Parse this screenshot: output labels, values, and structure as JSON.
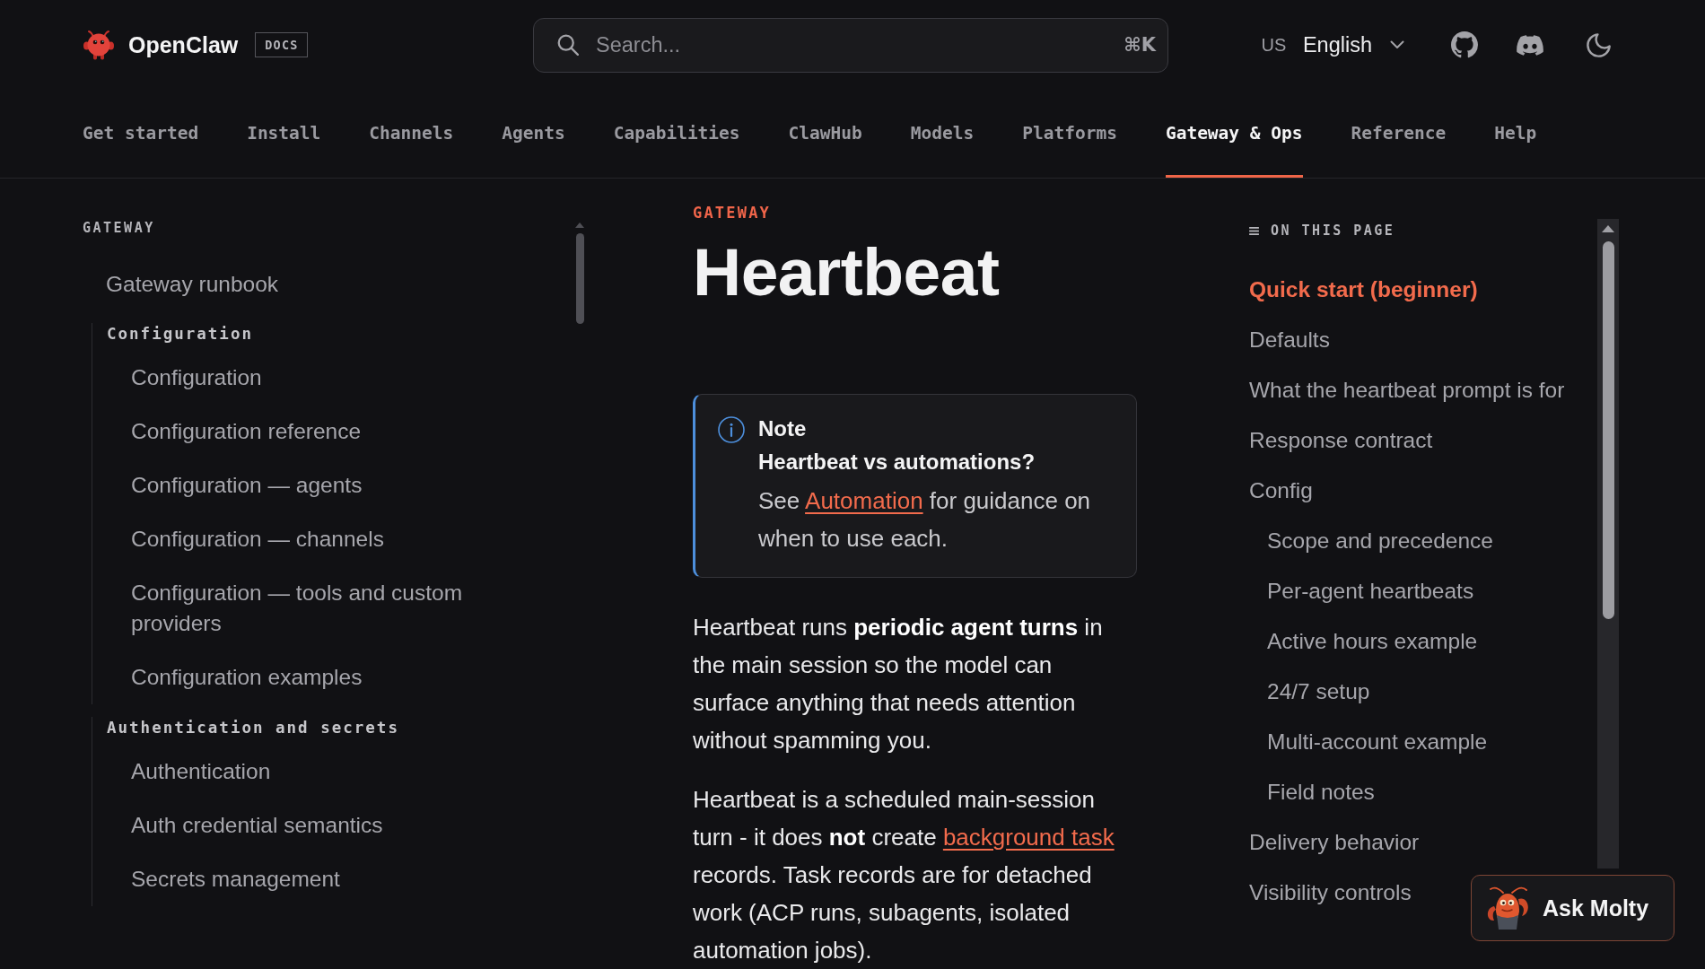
{
  "header": {
    "logo": {
      "name": "OpenClaw",
      "badge": "DOCS"
    },
    "search": {
      "placeholder": "Search...",
      "shortcut": "⌘K"
    },
    "language": {
      "code": "US",
      "name": "English"
    }
  },
  "nav": {
    "tabs": [
      {
        "label": "Get started",
        "selected": false
      },
      {
        "label": "Install",
        "selected": false
      },
      {
        "label": "Channels",
        "selected": false
      },
      {
        "label": "Agents",
        "selected": false
      },
      {
        "label": "Capabilities",
        "selected": false
      },
      {
        "label": "ClawHub",
        "selected": false
      },
      {
        "label": "Models",
        "selected": false
      },
      {
        "label": "Platforms",
        "selected": false
      },
      {
        "label": "Gateway & Ops",
        "selected": true
      },
      {
        "label": "Reference",
        "selected": false
      },
      {
        "label": "Help",
        "selected": false
      }
    ]
  },
  "sidebar": {
    "title": "GATEWAY",
    "items": [
      {
        "kind": "link",
        "label": "Gateway runbook"
      },
      {
        "kind": "group",
        "label": "Configuration",
        "children": [
          {
            "label": "Configuration"
          },
          {
            "label": "Configuration reference"
          },
          {
            "label": "Configuration — agents"
          },
          {
            "label": "Configuration — channels"
          },
          {
            "label": "Configuration — tools and custom providers"
          },
          {
            "label": "Configuration examples"
          }
        ]
      },
      {
        "kind": "group",
        "label": "Authentication and secrets",
        "children": [
          {
            "label": "Authentication"
          },
          {
            "label": "Auth credential semantics"
          },
          {
            "label": "Secrets management"
          }
        ]
      }
    ]
  },
  "article": {
    "eyebrow": "GATEWAY",
    "title": "Heartbeat",
    "note": {
      "label": "Note",
      "title": "Heartbeat vs automations?",
      "segments": [
        {
          "kind": "text",
          "text": "See "
        },
        {
          "kind": "link",
          "text": "Automation"
        },
        {
          "kind": "text",
          "text": " for guidance on when to use each."
        }
      ]
    },
    "paragraphs": [
      {
        "segments": [
          {
            "kind": "text",
            "text": "Heartbeat runs **periodic agent turns** in the main session so the model can surface anything that needs attention without spamming you."
          }
        ]
      },
      {
        "segments": [
          {
            "kind": "text",
            "text": "Heartbeat is a scheduled main-session turn - it does **not** create "
          },
          {
            "kind": "link",
            "text": "background task"
          },
          {
            "kind": "text",
            "text": " records. Task records are for detached work (ACP runs, subagents, isolated automation jobs)."
          }
        ]
      }
    ]
  },
  "toc": {
    "title": "ON THIS PAGE",
    "items": [
      {
        "label": "Quick start (beginner)",
        "selected": true
      },
      {
        "label": "Defaults",
        "selected": false
      },
      {
        "label": "What the heartbeat prompt is for",
        "selected": false
      },
      {
        "label": "Response contract",
        "selected": false
      },
      {
        "label": "Config",
        "selected": false,
        "children": [
          {
            "label": "Scope and precedence",
            "selected": false
          },
          {
            "label": "Per-agent heartbeats",
            "selected": false
          },
          {
            "label": "Active hours example",
            "selected": false
          },
          {
            "label": "24/7 setup",
            "selected": false
          },
          {
            "label": "Multi-account example",
            "selected": false
          },
          {
            "label": "Field notes",
            "selected": false
          }
        ]
      },
      {
        "label": "Delivery behavior",
        "selected": false
      },
      {
        "label": "Visibility controls",
        "selected": false
      }
    ]
  },
  "assistant": {
    "label": "Ask Molty"
  }
}
